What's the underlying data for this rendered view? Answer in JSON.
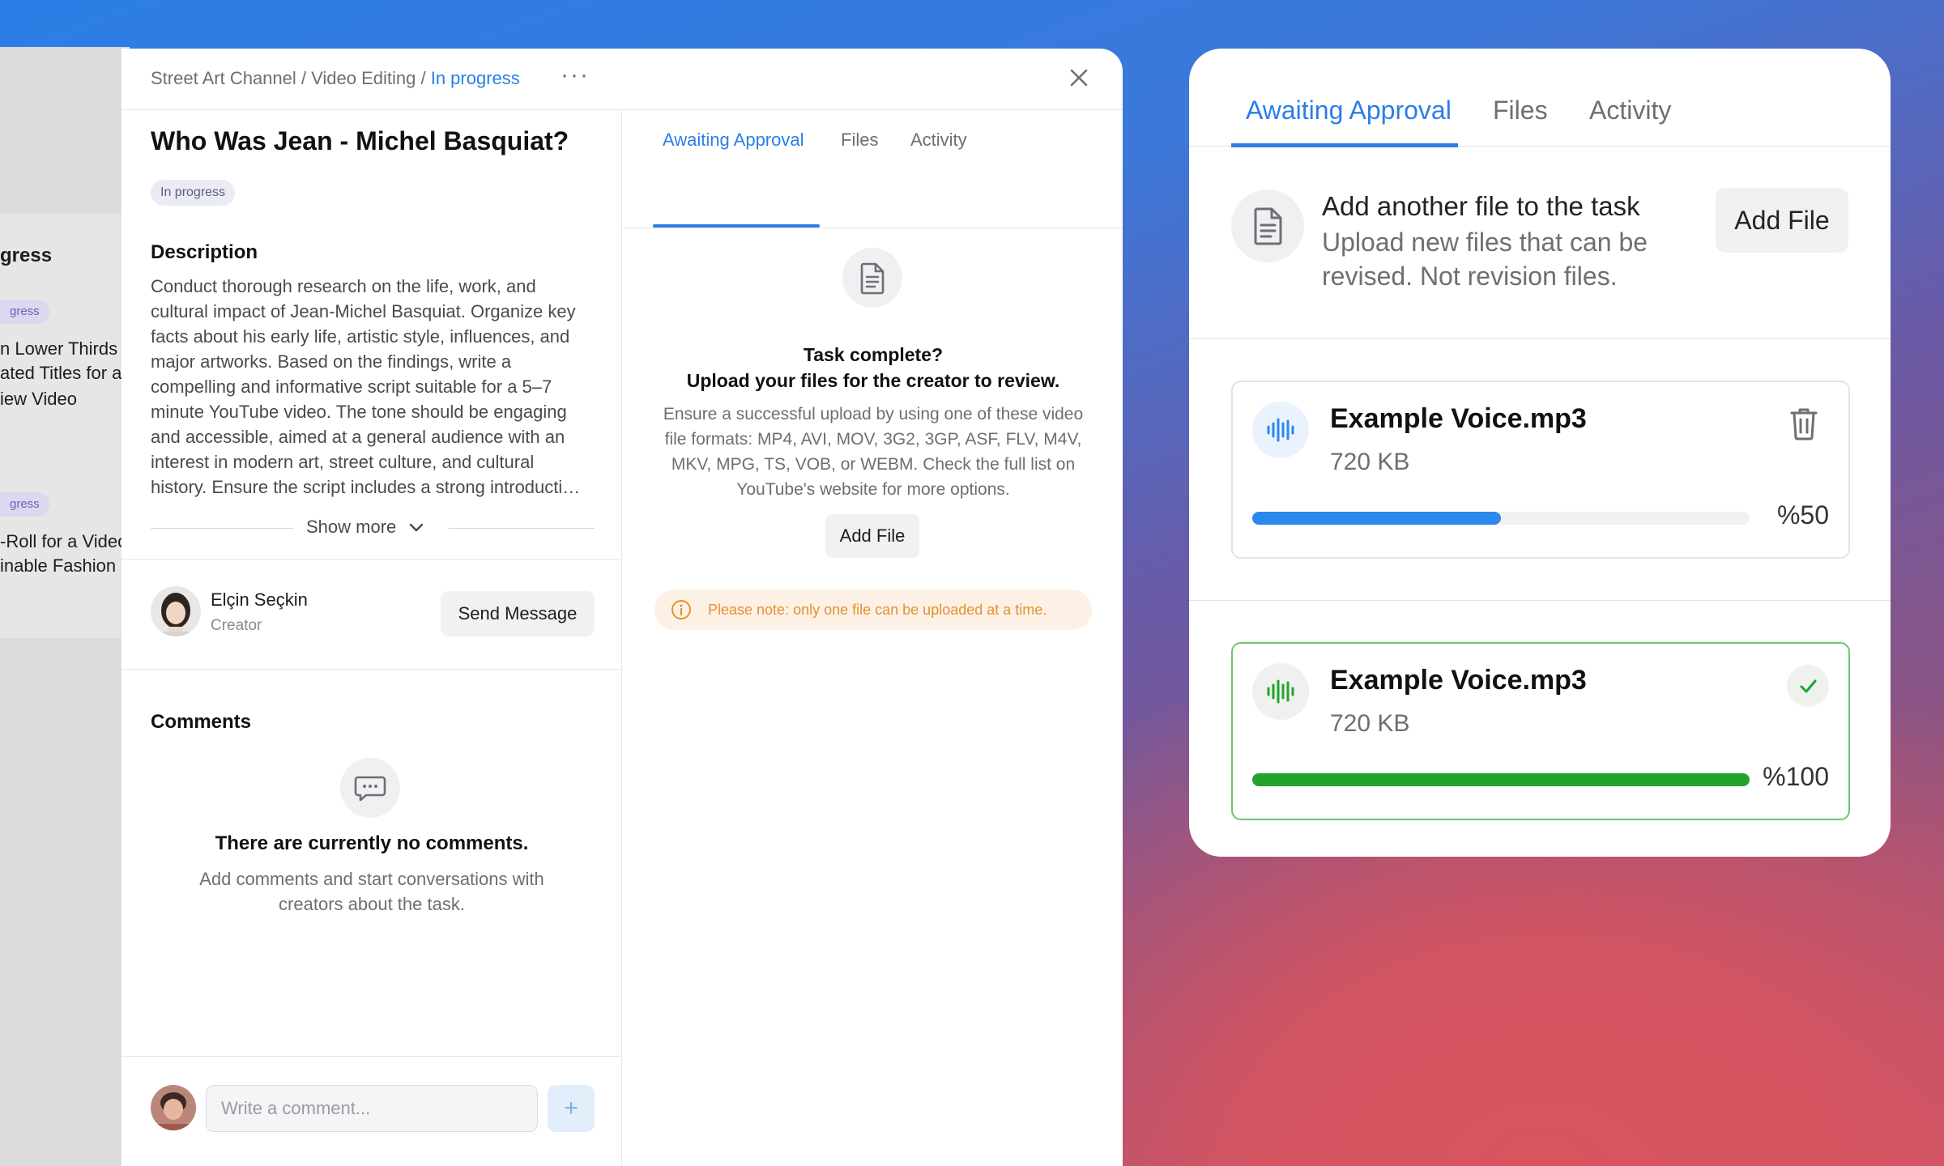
{
  "background_board": {
    "column_title": "gress",
    "pill_1": "gress",
    "item_1_lines": [
      "n Lower Thirds a",
      "ated Titles for an",
      "iew Video"
    ],
    "pill_2": "gress",
    "item_2_lines": [
      "-Roll for a Video",
      "inable Fashion"
    ]
  },
  "breadcrumb": {
    "channel": "Street Art Channel",
    "separator": " / ",
    "section": "Video Editing",
    "status": "In progress",
    "more_icon": "more-dots-icon",
    "close_icon": "close-icon"
  },
  "task": {
    "title": "Who Was Jean - Michel Basquiat?",
    "status": "In progress",
    "description_label": "Description",
    "description": "Conduct thorough research on the life, work, and cultural impact of Jean-Michel Basquiat. Organize key facts about his early life, artistic style, influences, and major artworks. Based on the findings, write a compelling and informative script suitable for a 5–7 minute YouTube video. The tone should be engaging and accessible, aimed at a general audience with an interest in modern art, street culture, and cultural history. Ensure the script includes a strong introducti…",
    "show_more": "Show more"
  },
  "creator": {
    "name": "Elçin Seçkin",
    "role": "Creator",
    "send_message": "Send Message"
  },
  "comments": {
    "title": "Comments",
    "empty_title": "There are currently no comments.",
    "empty_sub": "Add comments and start conversations with creators about the task.",
    "input_placeholder": "Write a comment...",
    "add_button": "+"
  },
  "upload_panel": {
    "tabs": [
      "Awaiting Approval",
      "Files",
      "Activity"
    ],
    "active_tab": "Awaiting Approval",
    "title_line1": "Task complete?",
    "title_line2": "Upload your files for the creator to review.",
    "formats_text": "Ensure a successful upload by using one of these video file formats: MP4, AVI, MOV, 3G2, 3GP, ASF, FLV, M4V, MKV, MPG, TS, VOB, or WEBM. Check the full list on YouTube's website for more options.",
    "add_file": "Add File",
    "note": "Please note: only one file can be uploaded at a time."
  },
  "card": {
    "tabs": [
      "Awaiting Approval",
      "Files",
      "Activity"
    ],
    "active_tab": "Awaiting Approval",
    "add_title": "Add another file to the task",
    "add_sub": "Upload new files that can be revised. Not revision files.",
    "add_button": "Add File",
    "files": [
      {
        "name": "Example Voice.mp3",
        "size": "720 KB",
        "percent_label": "%50",
        "progress": 0.5,
        "state": "uploading",
        "color": "#2b88ec"
      },
      {
        "name": "Example Voice.mp3",
        "size": "720 KB",
        "percent_label": "%100",
        "progress": 1.0,
        "state": "complete",
        "color": "#22a32a"
      }
    ]
  },
  "colors": {
    "accent": "#2b7ee6",
    "success": "#22a32a",
    "warning": "#e19230"
  }
}
